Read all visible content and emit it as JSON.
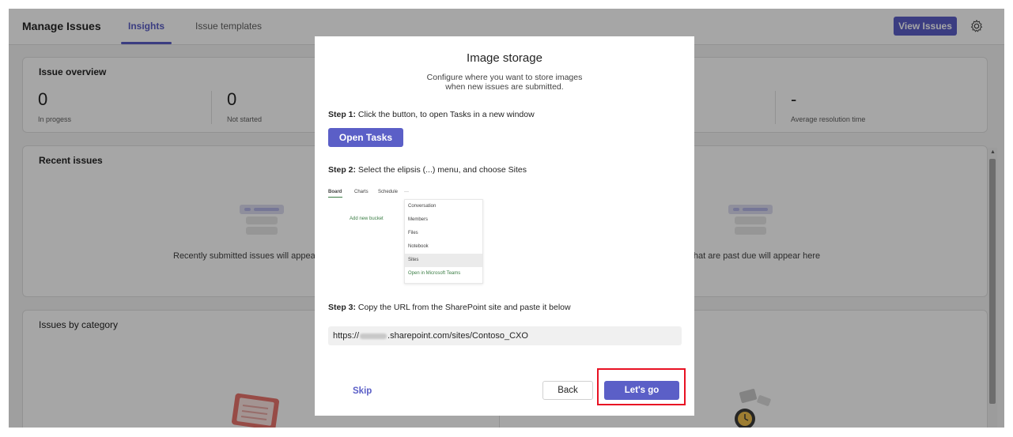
{
  "header": {
    "title": "Manage Issues",
    "tabs": [
      {
        "label": "Insights",
        "active": true
      },
      {
        "label": "Issue templates",
        "active": false
      }
    ],
    "view_issues_label": "View Issues",
    "settings_icon": "gear-icon"
  },
  "overview": {
    "title": "Issue overview",
    "stats": [
      {
        "value": "0",
        "label": "In progess"
      },
      {
        "value": "0",
        "label": "Not started"
      },
      {
        "value": "-",
        "label": "Average resolution time"
      }
    ]
  },
  "recent": {
    "title": "Recent issues",
    "left_message": "Recently submitted issues will appear here",
    "right_message": "Issues that are past due will appear here"
  },
  "category": {
    "title": "Issues by category"
  },
  "modal": {
    "title": "Image storage",
    "subtitle_line1": "Configure where you want to store images",
    "subtitle_line2": "when new issues are submitted.",
    "step1_label": "Step 1:",
    "step1_text": " Click the button, to open Tasks in a new window",
    "open_tasks_label": "Open Tasks",
    "step2_label": "Step 2:",
    "step2_text": " Select the elipsis (...) menu, and choose Sites",
    "preview": {
      "tabs": [
        "Board",
        "Charts",
        "Schedule",
        "···"
      ],
      "add_bucket": "Add new bucket",
      "menu_items": [
        "Conversation",
        "Members",
        "Files",
        "Notebook",
        "Sites",
        "Open in Microsoft Teams"
      ],
      "highlighted_item": "Sites"
    },
    "step3_label": "Step 3:",
    "step3_text": " Copy the URL from the SharePoint site and paste it below",
    "url_prefix": "https://",
    "url_suffix": ".sharepoint.com/sites/Contoso_CXO",
    "skip_label": "Skip",
    "back_label": "Back",
    "lets_go_label": "Let's go"
  },
  "colors": {
    "accent": "#5b5fc7",
    "highlight_border": "#e81123"
  }
}
